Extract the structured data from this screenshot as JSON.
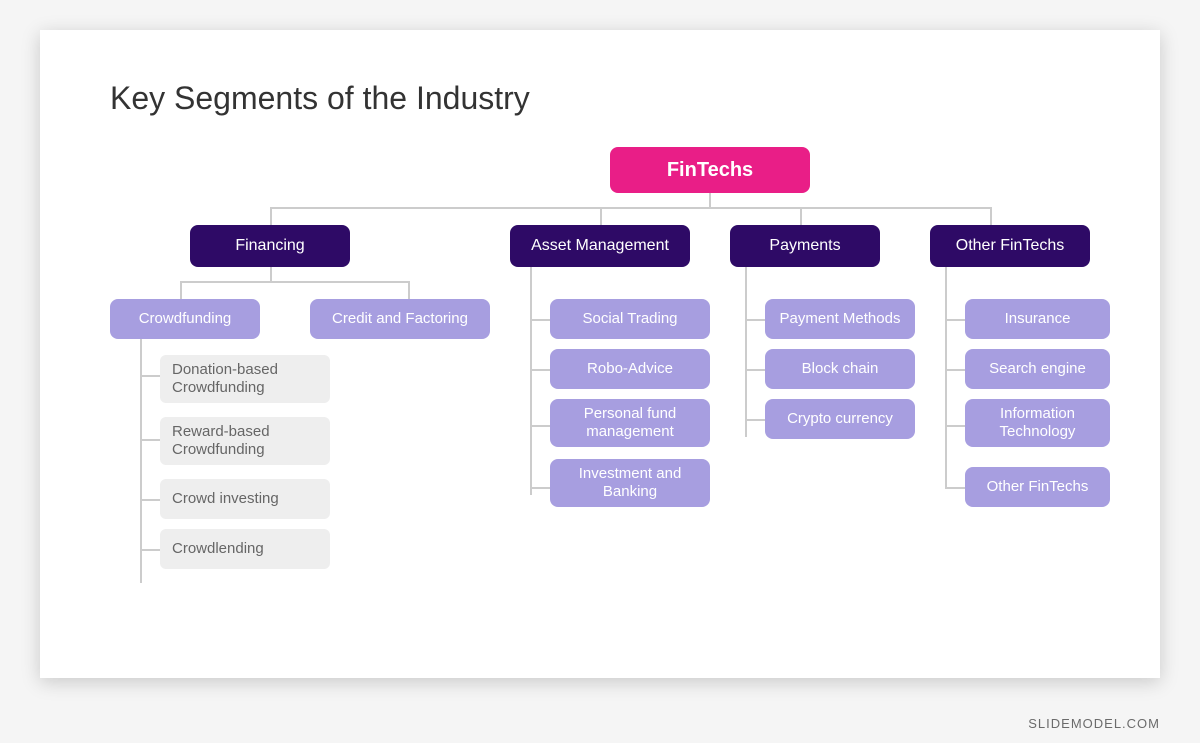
{
  "title": "Key Segments of the Industry",
  "footer": "SLIDEMODEL.COM",
  "colors": {
    "root": "#e91e87",
    "branch": "#2e0a66",
    "sub": "#a79ee0",
    "leaf_bg": "#eeeeee",
    "leaf_text": "#666666"
  },
  "tree": {
    "root": "FinTechs",
    "branches": [
      {
        "label": "Financing",
        "children": [
          {
            "label": "Crowdfunding",
            "children": [
              {
                "label": "Donation-based Crowdfunding"
              },
              {
                "label": "Reward-based Crowdfunding"
              },
              {
                "label": "Crowd investing"
              },
              {
                "label": "Crowdlending"
              }
            ]
          },
          {
            "label": "Credit and Factoring"
          }
        ]
      },
      {
        "label": "Asset Management",
        "children": [
          {
            "label": "Social Trading"
          },
          {
            "label": "Robo-Advice"
          },
          {
            "label": "Personal fund management"
          },
          {
            "label": "Investment and Banking"
          }
        ]
      },
      {
        "label": "Payments",
        "children": [
          {
            "label": "Payment Methods"
          },
          {
            "label": "Block chain"
          },
          {
            "label": "Crypto currency"
          }
        ]
      },
      {
        "label": "Other FinTechs",
        "children": [
          {
            "label": "Insurance"
          },
          {
            "label": "Search engine"
          },
          {
            "label": "Information Technology"
          },
          {
            "label": "Other FinTechs"
          }
        ]
      }
    ]
  }
}
